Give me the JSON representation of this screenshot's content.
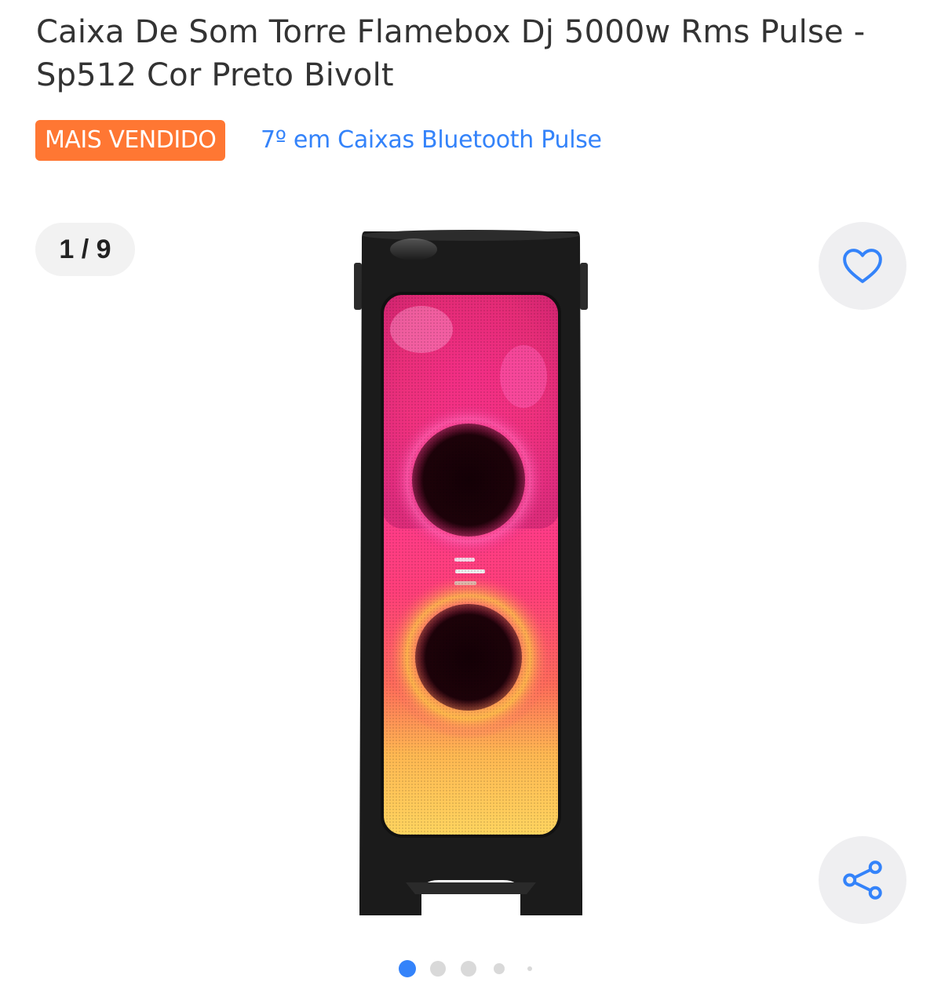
{
  "product": {
    "title": "Caixa De Som Torre Flamebox Dj 5000w Rms Pulse - Sp512 Cor Preto Bivolt",
    "badge": "MAIS VENDIDO",
    "ranking_link": "7º em Caixas Bluetooth Pulse"
  },
  "gallery": {
    "counter": "1 / 9",
    "current": 1,
    "total": 9,
    "favorite_icon": "heart-icon",
    "share_icon": "share-icon"
  },
  "colors": {
    "badge_bg": "#ff7733",
    "link": "#3483fa",
    "dot_active": "#3483fa",
    "dot_inactive": "#d9d9d9"
  }
}
